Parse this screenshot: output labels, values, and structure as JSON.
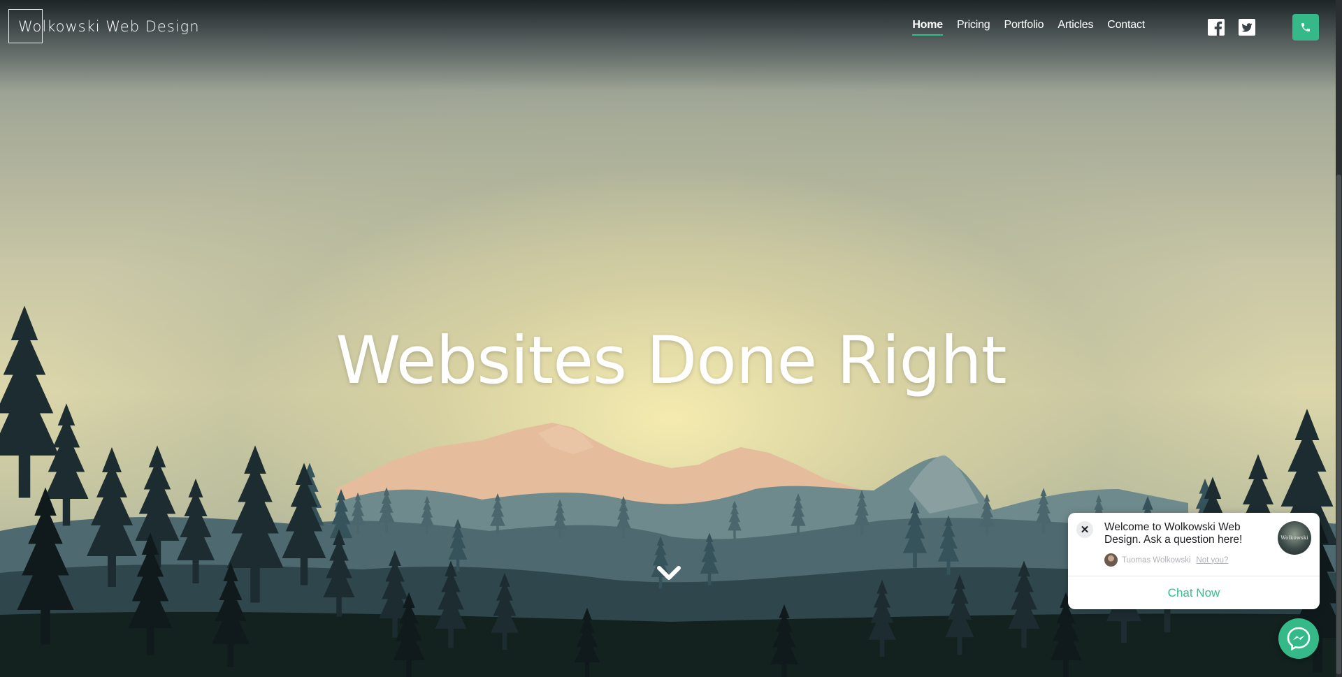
{
  "site": {
    "logo_text": "Wolkowski Web Design"
  },
  "nav": {
    "items": [
      {
        "label": "Home",
        "active": true
      },
      {
        "label": "Pricing",
        "active": false
      },
      {
        "label": "Portfolio",
        "active": false
      },
      {
        "label": "Articles",
        "active": false
      },
      {
        "label": "Contact",
        "active": false
      }
    ],
    "social_icons": [
      "facebook-icon",
      "twitter-icon"
    ],
    "phone_icon": "phone-icon"
  },
  "hero": {
    "headline": "Websites Done Right",
    "scroll_icon": "chevron-down-icon"
  },
  "chat": {
    "message": "Welcome to Wolkowski Web Design. Ask a question here!",
    "agent_name": "Tuomas Wolkowski",
    "not_you": "Not you?",
    "avatar_text": "Wolkowski",
    "cta": "Chat Now",
    "close_symbol": "✕",
    "messenger_icon": "messenger-icon"
  },
  "colors": {
    "accent": "#35b988",
    "nav_underline": "#2fbf8a",
    "text_white": "#ffffff"
  }
}
